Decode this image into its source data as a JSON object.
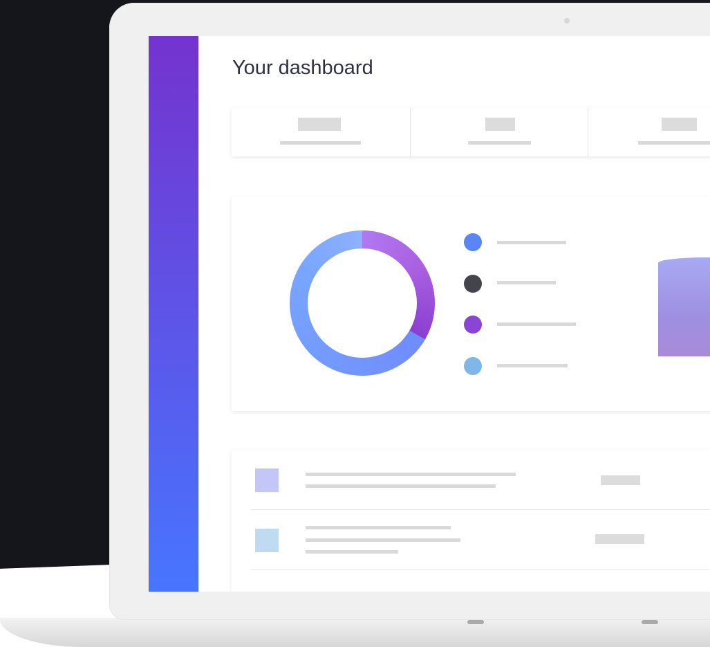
{
  "page": {
    "title": "Your dashboard"
  },
  "colors": {
    "sidebar_top": "#7433cf",
    "sidebar_bottom": "#4775ff",
    "legend": [
      "#5b85f5",
      "#44444d",
      "#8a45d4",
      "#7eb7e8"
    ],
    "thumbs": [
      "#c3c6f6",
      "#bfdbf2"
    ]
  },
  "chart_data": {
    "type": "pie",
    "title": "",
    "values": [
      33,
      67
    ],
    "colors": [
      "#a95fe0",
      "#78a6ff"
    ]
  },
  "icons": [
    "camera-icon"
  ]
}
